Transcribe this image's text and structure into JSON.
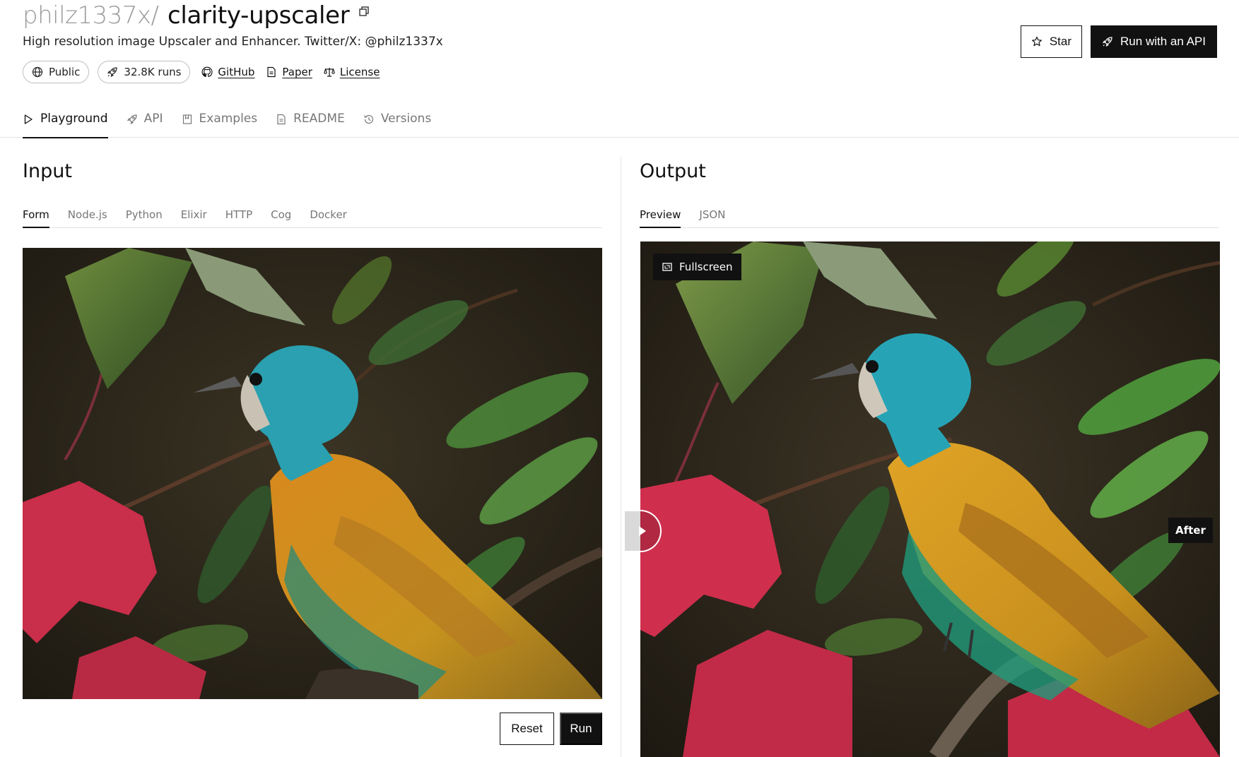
{
  "header": {
    "owner": "philz1337x",
    "separator": "/",
    "model": "clarity-upscaler",
    "description": "High resolution image Upscaler and Enhancer. Twitter/X: @philz1337x",
    "visibility_label": "Public",
    "runs_label": "32.8K runs",
    "links": {
      "github": "GitHub",
      "paper": "Paper",
      "license": "License"
    },
    "star_label": "Star",
    "api_label": "Run with an API"
  },
  "tabs": {
    "playground": "Playground",
    "api": "API",
    "examples": "Examples",
    "readme": "README",
    "versions": "Versions"
  },
  "input": {
    "title": "Input",
    "subtabs": [
      "Form",
      "Node.js",
      "Python",
      "Elixir",
      "HTTP",
      "Cog",
      "Docker"
    ],
    "reset_label": "Reset",
    "run_label": "Run"
  },
  "output": {
    "title": "Output",
    "subtabs": [
      "Preview",
      "JSON"
    ],
    "fullscreen_label": "Fullscreen",
    "after_label": "After"
  },
  "colors": {
    "accent": "#111111",
    "muted": "#777777",
    "border": "#e3e3e3"
  },
  "icons": {
    "copy": "copy-icon",
    "globe": "globe-icon",
    "rocket": "rocket-icon",
    "github": "github-icon",
    "paper": "document-icon",
    "license": "scale-icon",
    "star": "star-icon",
    "play": "play-icon",
    "examples": "bookmark-icon",
    "readme": "document-icon",
    "versions": "history-icon",
    "fullscreen": "fullscreen-icon"
  }
}
